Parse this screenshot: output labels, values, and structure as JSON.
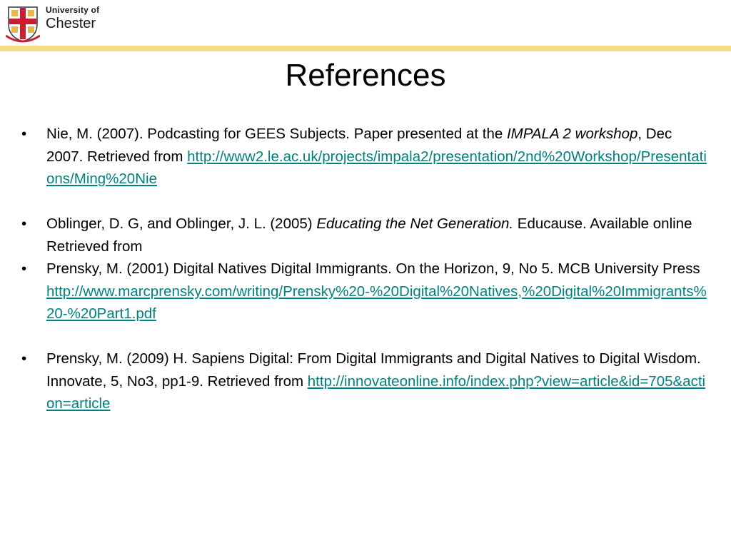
{
  "header": {
    "logo_line1": "University of",
    "logo_line2": "Chester"
  },
  "slide": {
    "title": "References"
  },
  "bullet_glyph": "•",
  "references": [
    {
      "before": "Nie, M. (2007). Podcasting for GEES Subjects. Paper presented at the ",
      "italic": "IMPALA 2 workshop",
      "after": ", Dec 2007. Retrieved from ",
      "link": "http://www2.le.ac.uk/projects/impala2/presentation/2nd%20Workshop/Presentations/Ming%20Nie"
    },
    {
      "before": "Oblinger, D. G, and Oblinger, J. L. (2005) ",
      "italic": "Educating the Net Generation.",
      "after": " Educause. Available online Retrieved from",
      "link": ""
    },
    {
      "before": "Prensky, M. (2001) Digital Natives Digital Immigrants. On the Horizon, 9, No 5. MCB University Press ",
      "italic": "",
      "after": "",
      "link": "http://www.marcprensky.com/writing/Prensky%20-%20Digital%20Natives,%20Digital%20Immigrants%20-%20Part1.pdf"
    },
    {
      "before": "Prensky, M. (2009) H. Sapiens Digital: From Digital Immigrants and Digital Natives to Digital Wisdom.  Innovate, 5, No3, pp1-9. Retrieved from ",
      "italic": "",
      "after": "",
      "link": "http://innovateonline.info/index.php?view=article&id=705&action=article"
    }
  ],
  "colors": {
    "header_band": "#f6da86",
    "link": "#008080",
    "crest_red": "#c8202f",
    "crest_gold": "#e3b94a"
  },
  "icons": {
    "logo_crest": "university-crest-icon"
  }
}
